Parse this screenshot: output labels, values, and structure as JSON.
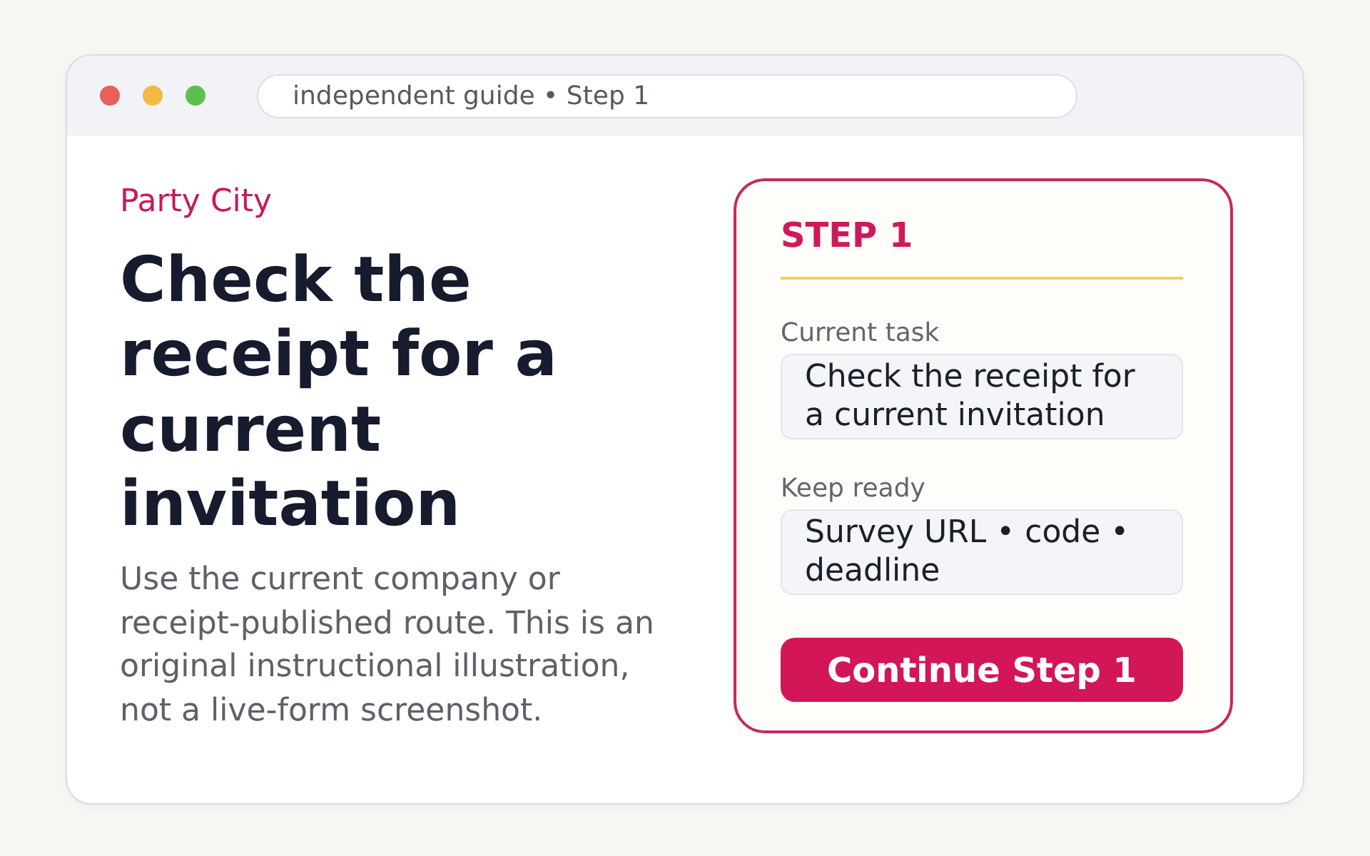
{
  "window": {
    "controls": [
      {
        "color": "#e8605a"
      },
      {
        "color": "#f4b942"
      },
      {
        "color": "#5cc04f"
      }
    ],
    "address": "independent guide • Step 1"
  },
  "content": {
    "brand": "Party City",
    "heading": "Check the receipt for a current invitation",
    "description": "Use the current company or receipt-published route. This is an original instructional illustration, not a live-form screenshot."
  },
  "step_card": {
    "title": "STEP 1",
    "fields": [
      {
        "label": "Current task",
        "value": "Check the receipt for a current invitation"
      },
      {
        "label": "Keep ready",
        "value": "Survey URL • code • deadline"
      }
    ],
    "button": "Continue Step 1"
  }
}
